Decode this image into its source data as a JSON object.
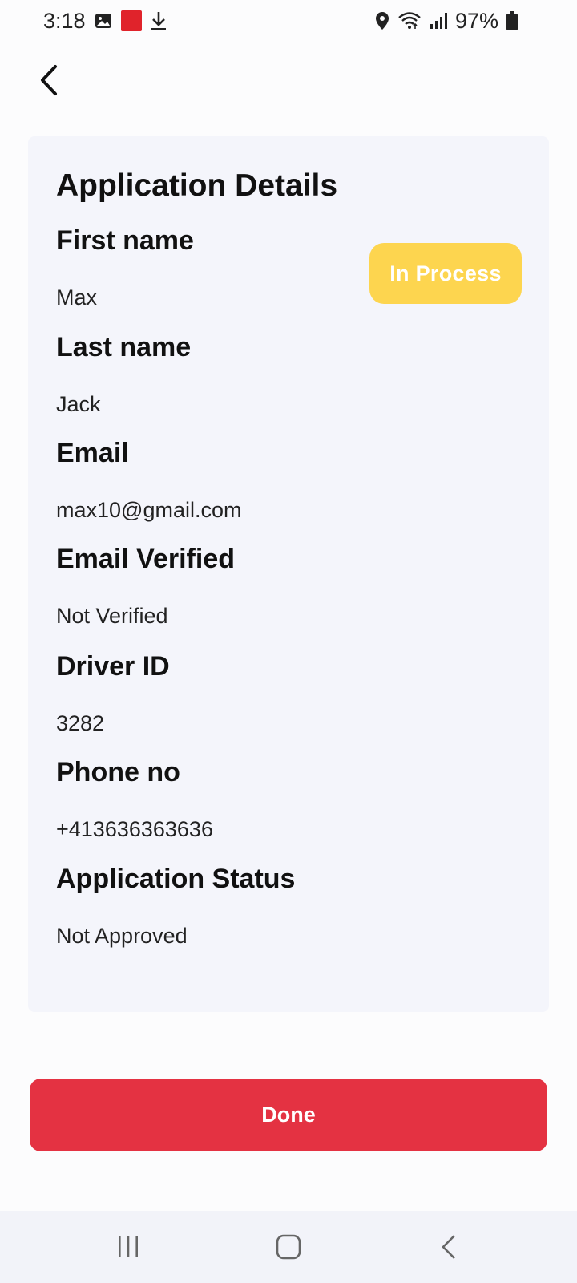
{
  "status_bar": {
    "time": "3:18",
    "battery": "97%",
    "left_icons": [
      "gallery-icon",
      "news-app-icon",
      "download-icon"
    ],
    "right_icons": [
      "location-icon",
      "wifi-icon",
      "signal-icon",
      "battery-icon"
    ]
  },
  "card": {
    "title": "Application Details",
    "status_badge": "In Process",
    "fields": [
      {
        "label": "First name",
        "value": "Max"
      },
      {
        "label": "Last name",
        "value": "Jack"
      },
      {
        "label": "Email",
        "value": "max10@gmail.com"
      },
      {
        "label": "Email Verified",
        "value": "Not Verified"
      },
      {
        "label": "Driver ID",
        "value": "3282"
      },
      {
        "label": "Phone no",
        "value": "+413636363636"
      },
      {
        "label": "Application Status",
        "value": "Not Approved"
      }
    ]
  },
  "done_label": "Done",
  "colors": {
    "card_bg": "#f4f5fb",
    "badge_bg": "#fdd54f",
    "done_bg": "#e43242"
  }
}
